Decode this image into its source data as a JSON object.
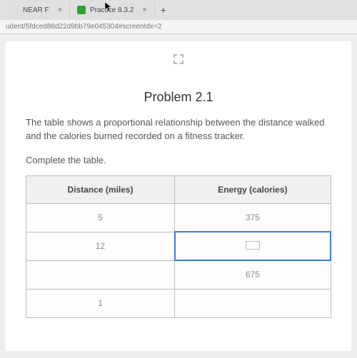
{
  "tabs": {
    "tab1": {
      "label": "NEAR F"
    },
    "tab2": {
      "label": "Practice 8.3.2"
    },
    "newTab": "+"
  },
  "urlBar": "udent/5fdced88d22d9bb79e045304#screenIdx=2",
  "fullscreenGlyph": "⤢",
  "problem": {
    "title": "Problem 2.1",
    "description": "The table shows a proportional relationship between the distance walked and the calories burned recorded on a fitness tracker.",
    "instruction": "Complete the table."
  },
  "table": {
    "headers": {
      "col1": "Distance (miles)",
      "col2": "Energy (calories)"
    },
    "rows": [
      {
        "c1": "5",
        "c2": "375"
      },
      {
        "c1": "12",
        "c2": ""
      },
      {
        "c1": "",
        "c2": "675"
      },
      {
        "c1": "1",
        "c2": ""
      }
    ]
  }
}
